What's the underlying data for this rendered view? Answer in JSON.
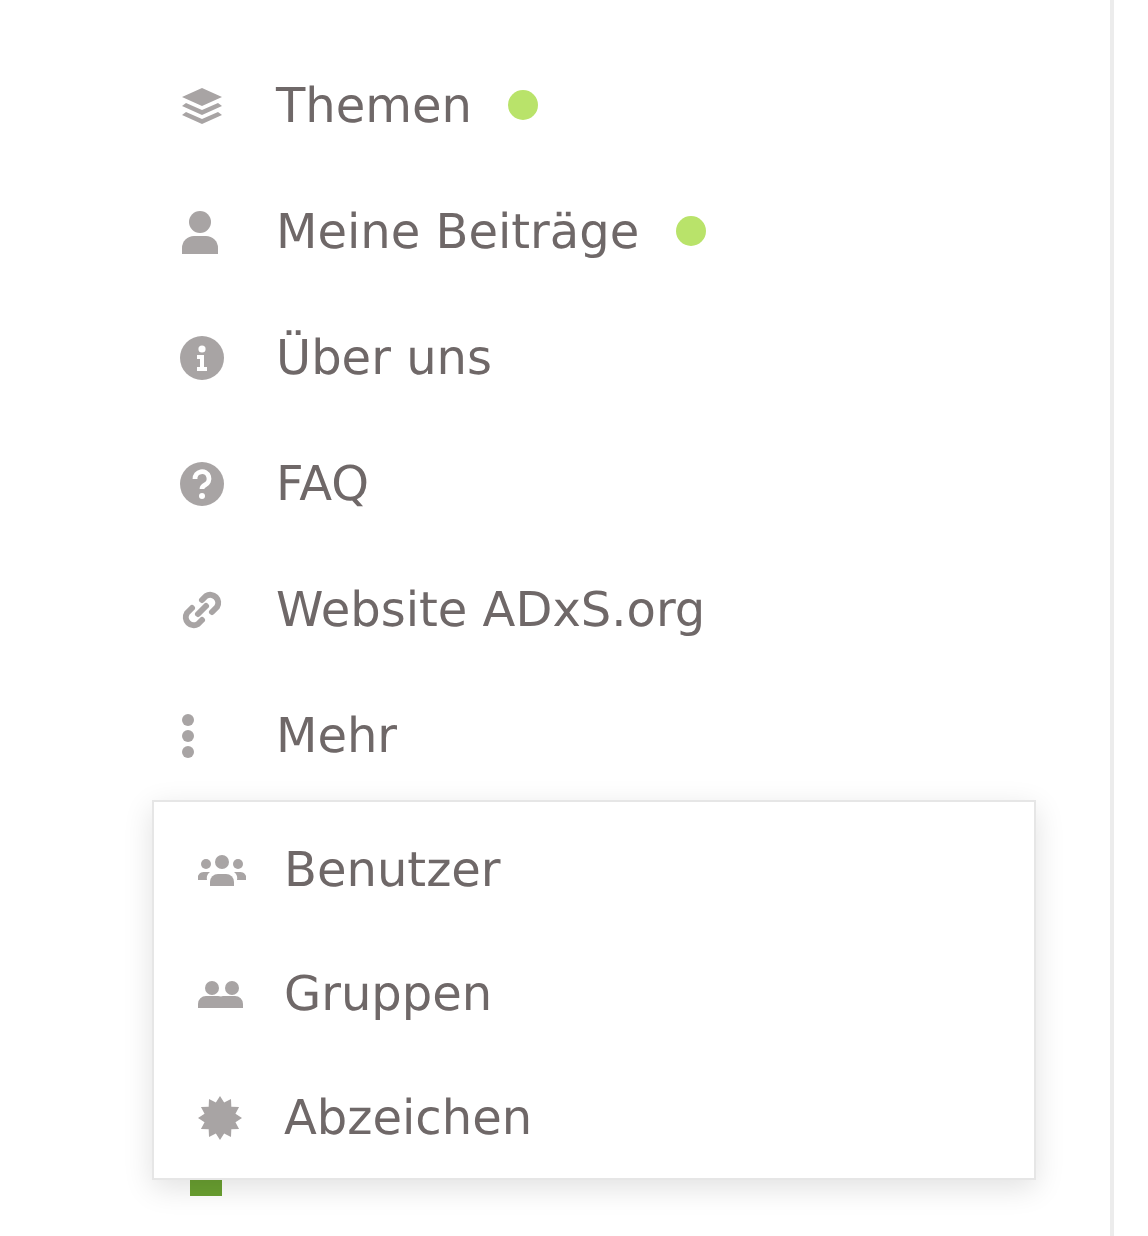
{
  "nav": [
    {
      "label": "Themen",
      "unread": true
    },
    {
      "label": "Meine Beiträge",
      "unread": true
    },
    {
      "label": "Über uns",
      "unread": false
    },
    {
      "label": "FAQ",
      "unread": false
    },
    {
      "label": "Website ADxS.org",
      "unread": false
    },
    {
      "label": "Mehr",
      "unread": false
    }
  ],
  "more_menu": [
    {
      "label": "Benutzer"
    },
    {
      "label": "Gruppen"
    },
    {
      "label": "Abzeichen"
    }
  ],
  "category_behind": {
    "color": "#6aa031"
  }
}
